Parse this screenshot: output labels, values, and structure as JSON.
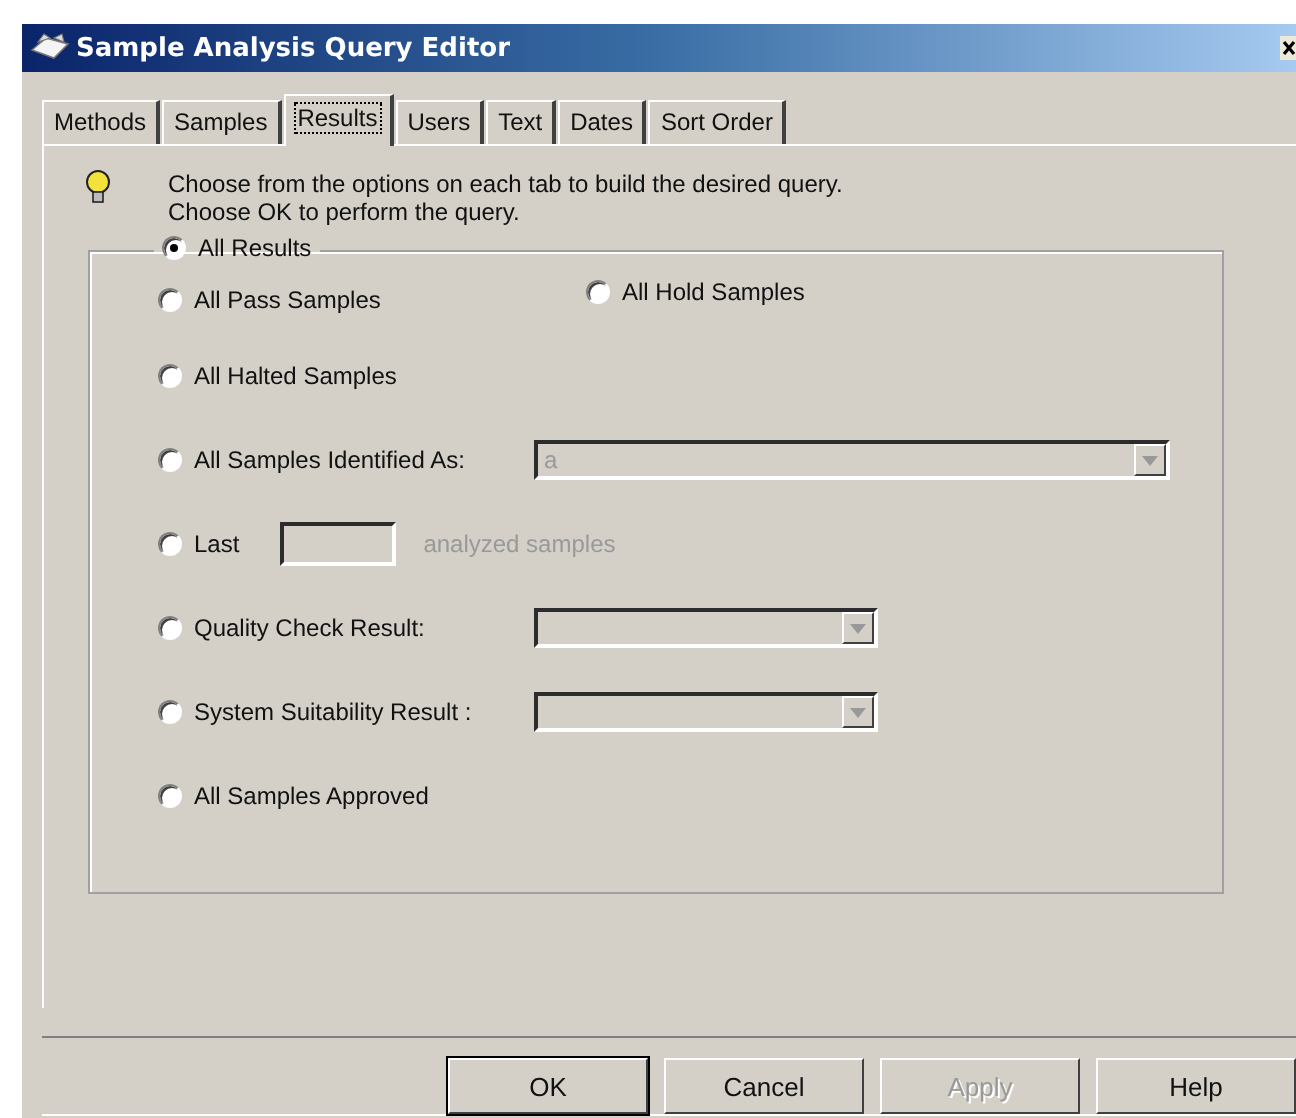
{
  "window": {
    "title": "Sample Analysis Query Editor"
  },
  "tabs": [
    {
      "label": "Methods",
      "selected": false
    },
    {
      "label": "Samples",
      "selected": false
    },
    {
      "label": "Results",
      "selected": true
    },
    {
      "label": "Users",
      "selected": false
    },
    {
      "label": "Text",
      "selected": false
    },
    {
      "label": "Dates",
      "selected": false
    },
    {
      "label": "Sort Order",
      "selected": false
    }
  ],
  "hint": [
    "Choose from the options on each tab to build the desired query.",
    "Choose OK to perform the query."
  ],
  "group": {
    "label": "All Results",
    "selected": true
  },
  "rows": [
    [
      {
        "kind": "radio",
        "label": "All Pass Samples",
        "selected": false
      },
      {
        "kind": "radio",
        "label": "All Hold Samples",
        "selected": false
      }
    ],
    [
      {
        "kind": "radio",
        "label": "All Halted Samples",
        "selected": false
      }
    ],
    [
      {
        "kind": "dropdown",
        "label": "All Samples Identified As:",
        "selected": false,
        "value": "a",
        "disabled": true,
        "wide": true
      }
    ],
    [
      {
        "kind": "count",
        "label": "Last",
        "selected": false,
        "suffix": "analyzed samples",
        "disabled": true
      }
    ],
    [
      {
        "kind": "dropdown",
        "label": "Quality Check Result:",
        "selected": false,
        "disabled": true,
        "wide": false
      }
    ],
    [
      {
        "kind": "dropdown",
        "label": "System Suitability Result :",
        "selected": false,
        "disabled": true,
        "wide": false
      }
    ],
    [
      {
        "kind": "radio",
        "label": "All Samples Approved",
        "selected": false
      }
    ]
  ],
  "buttons": [
    {
      "label": "OK",
      "default": true,
      "disabled": false
    },
    {
      "label": "Cancel",
      "default": false,
      "disabled": false
    },
    {
      "label": "Apply",
      "default": false,
      "disabled": true
    },
    {
      "label": "Help",
      "default": false,
      "disabled": false
    }
  ]
}
